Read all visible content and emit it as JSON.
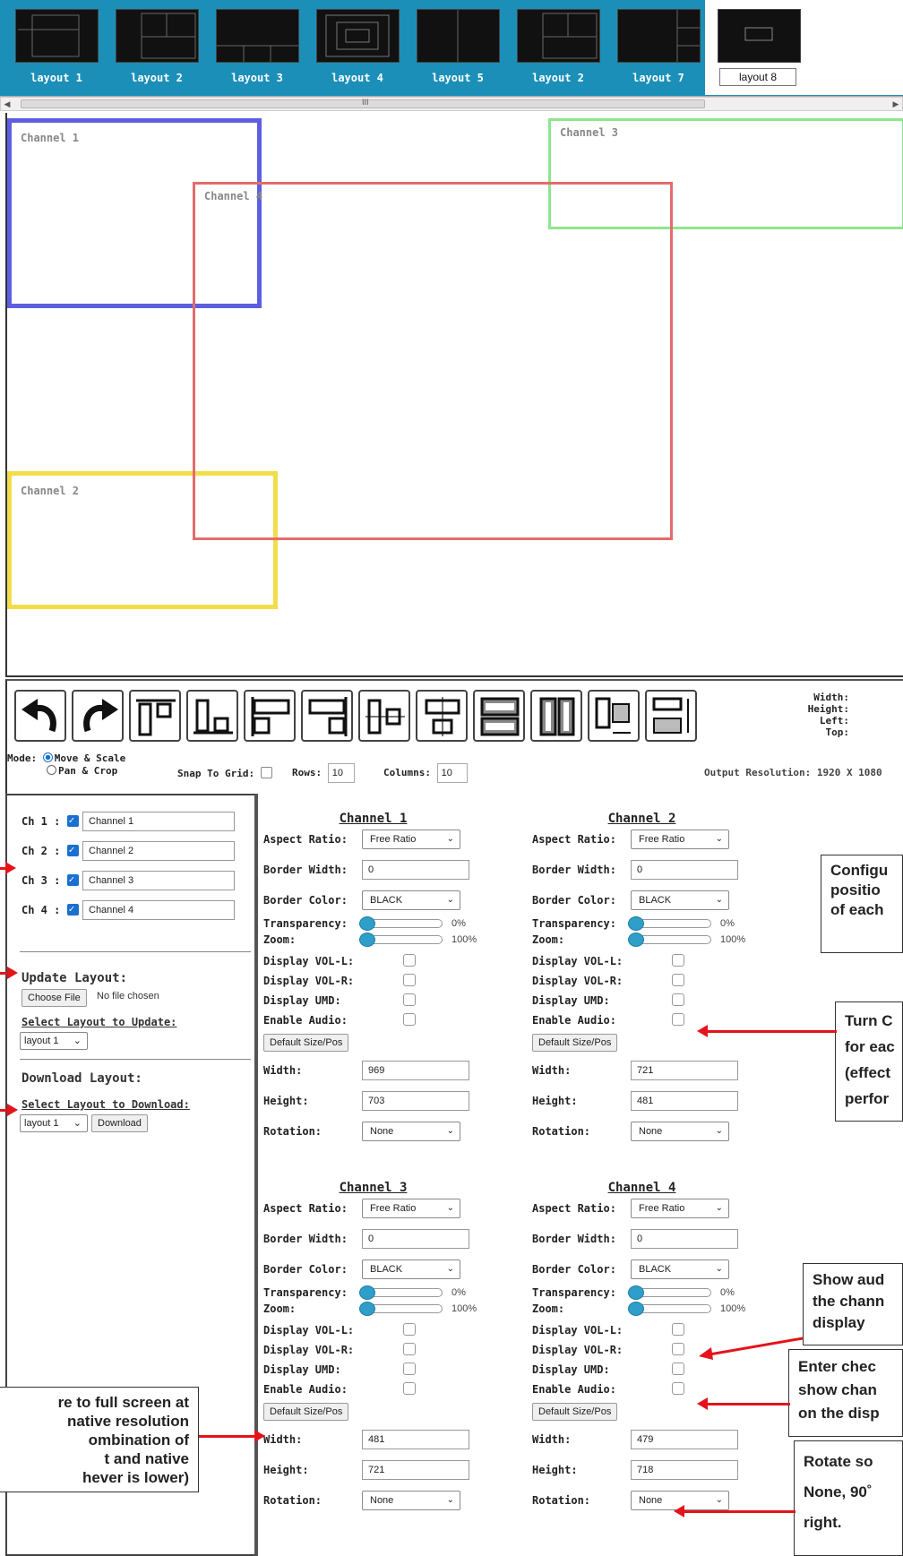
{
  "layouts": [
    {
      "label": "layout 1"
    },
    {
      "label": "layout 2"
    },
    {
      "label": "layout 3"
    },
    {
      "label": "layout 4"
    },
    {
      "label": "layout 5"
    },
    {
      "label": "layout 2"
    },
    {
      "label": "layout 7"
    },
    {
      "label": "layout 8"
    }
  ],
  "scrollbar": {
    "left_arrow": "◀",
    "right_arrow": "▶",
    "grip": "III"
  },
  "canvas": {
    "channels": [
      {
        "label": "Channel 1",
        "color": "#5d5fe0"
      },
      {
        "label": "Channel 2",
        "color": "#f2dd4a"
      },
      {
        "label": "Channel 3",
        "color": "#8ee58e"
      },
      {
        "label": "Channel 4",
        "color": "#e26c6c"
      }
    ]
  },
  "toolbar": {
    "dims": {
      "width": "Width:",
      "height": "Height:",
      "left": "Left:",
      "top": "Top:"
    },
    "mode_label": "Mode:",
    "mode_move": "Move & Scale",
    "mode_pan": "Pan & Crop",
    "snap_label": "Snap To Grid:",
    "rows_label": "Rows:",
    "rows_value": "10",
    "columns_label": "Columns:",
    "columns_value": "10",
    "output_resolution": "Output Resolution: 1920 X 1080"
  },
  "left": {
    "channels": [
      {
        "label": "Ch 1 :",
        "name": "Channel 1"
      },
      {
        "label": "Ch 2 :",
        "name": "Channel 2"
      },
      {
        "label": "Ch 3 :",
        "name": "Channel 3"
      },
      {
        "label": "Ch 4 :",
        "name": "Channel 4"
      }
    ],
    "update_title": "Update Layout:",
    "choose_file": "Choose File",
    "no_file": "No file chosen",
    "select_update_label": "Select Layout to Update:",
    "select_update_value": "layout 1",
    "download_title": "Download Layout:",
    "select_download_label": "Select Layout to Download:",
    "select_download_value": "layout 1",
    "download_button": "Download"
  },
  "labels": {
    "aspect_ratio": "Aspect Ratio:",
    "border_width": "Border Width:",
    "border_color": "Border Color:",
    "transparency": "Transparency:",
    "zoom": "Zoom:",
    "vol_l": "Display VOL-L:",
    "vol_r": "Display VOL-R:",
    "umd": "Display UMD:",
    "audio": "Enable Audio:",
    "default_btn": "Default Size/Pos",
    "width": "Width:",
    "height": "Height:",
    "rotation": "Rotation:"
  },
  "panels": [
    {
      "title": "Channel 1",
      "aspect": "Free Ratio",
      "border_width": "0",
      "border_color": "BLACK",
      "transparency": "0%",
      "zoom": "100%",
      "width": "969",
      "height": "703",
      "rotation": "None"
    },
    {
      "title": "Channel 2",
      "aspect": "Free Ratio",
      "border_width": "0",
      "border_color": "BLACK",
      "transparency": "0%",
      "zoom": "100%",
      "width": "721",
      "height": "481",
      "rotation": "None"
    },
    {
      "title": "Channel 3",
      "aspect": "Free Ratio",
      "border_width": "0",
      "border_color": "BLACK",
      "transparency": "0%",
      "zoom": "100%",
      "width": "481",
      "height": "721",
      "rotation": "None"
    },
    {
      "title": "Channel 4",
      "aspect": "Free Ratio",
      "border_width": "0",
      "border_color": "BLACK",
      "transparency": "0%",
      "zoom": "100%",
      "width": "479",
      "height": "718",
      "rotation": "None"
    }
  ],
  "callouts": {
    "configure": [
      "Configu",
      "positio",
      "of each"
    ],
    "turn": [
      "Turn C",
      "for eac",
      "(effect",
      "perfor"
    ],
    "show_audio": [
      "Show aud",
      "the chann",
      "display"
    ],
    "enter_check": [
      "Enter chec",
      "show chan",
      "on the disp"
    ],
    "rotate": [
      "Rotate so",
      "None, 90˚",
      "right."
    ],
    "fullscreen": [
      "re to full screen at",
      "native resolution",
      "ombination of",
      "t and native",
      "hever is lower)"
    ]
  },
  "colors": {
    "strip": "#1b8fb8",
    "arrow": "#e3141b",
    "slider": "#2f9ec9",
    "checkbox": "#1a6fd0"
  }
}
